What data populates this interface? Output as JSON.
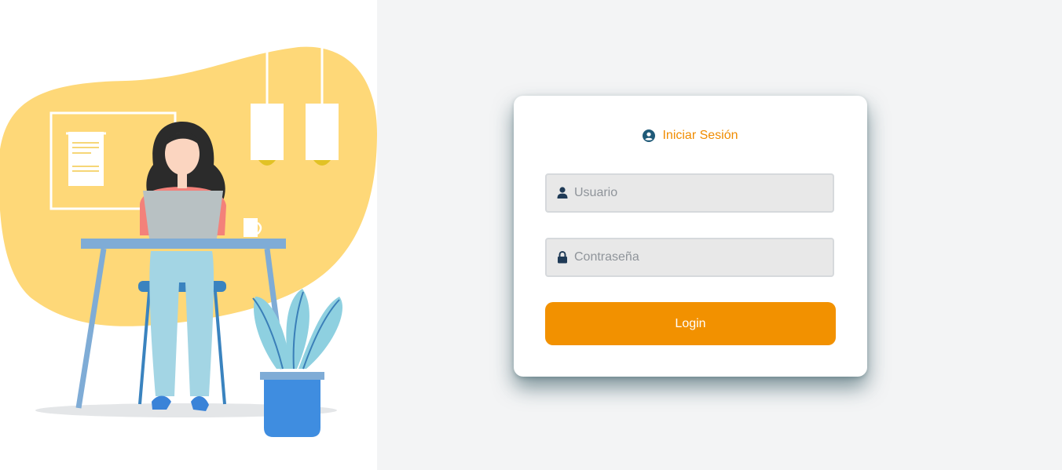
{
  "illustration": {
    "icon": "woman-working-on-laptop-illustration",
    "colors": {
      "blob": "#fed878",
      "desk": "#7facd6",
      "plant_pot": "#3f8de0",
      "leaves": "#8ed0e0"
    }
  },
  "login": {
    "title": "Iniciar Sesión",
    "title_icon": "user-circle-icon",
    "username": {
      "placeholder": "Usuario",
      "value": "",
      "icon": "user-icon"
    },
    "password": {
      "placeholder": "Contraseña",
      "value": "",
      "icon": "lock-icon"
    },
    "button_label": "Login"
  },
  "colors": {
    "accent": "#f29100",
    "title_text": "#f08c00",
    "icon": "#1f5a78",
    "background": "#f3f4f5",
    "card": "#ffffff",
    "input_bg": "#e8e8e8"
  }
}
